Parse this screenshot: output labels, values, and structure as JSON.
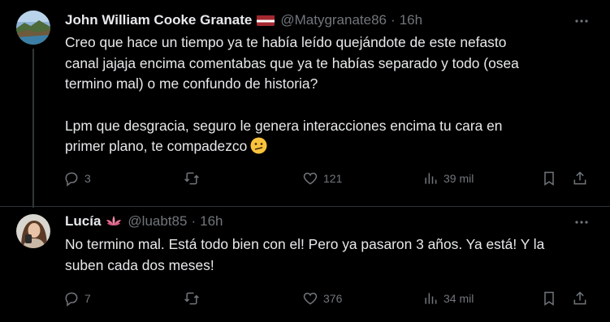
{
  "tweets": [
    {
      "name": "John William Cooke Granate",
      "name_badge": "latvia-flag",
      "handle": "@Matygranate86",
      "separator": "·",
      "time": "16h",
      "text_lines": [
        "Creo que hace un tiempo ya te había leído quejándote de este nefasto",
        "canal jajaja encima comentabas que ya te habías separado y todo (osea",
        "termino mal) o me confundo de historia?"
      ],
      "text_lines_2": [
        "Lpm que desgracia, seguro le genera interacciones encima tu cara en",
        "primer plano, te compadezco"
      ],
      "emoji": "confused-face",
      "replies": "3",
      "retweets": "",
      "likes": "121",
      "views": "39 mil"
    },
    {
      "name": "Lucía",
      "name_badge": "lotus-emoji",
      "handle": "@luabt85",
      "separator": "·",
      "time": "16h",
      "text_lines": [
        "No termino mal. Está todo bien con el! Pero ya pasaron 3 años. Ya está! Y la",
        "suben cada dos meses!"
      ],
      "replies": "7",
      "retweets": "",
      "likes": "376",
      "views": "34 mil"
    }
  ],
  "colors": {
    "background": "#000000",
    "text": "#e7e9ea",
    "secondary": "#71767b",
    "divider": "#2f3336"
  },
  "icons": [
    "more-icon",
    "reply-icon",
    "retweet-icon",
    "like-icon",
    "views-icon",
    "bookmark-icon",
    "share-icon"
  ]
}
